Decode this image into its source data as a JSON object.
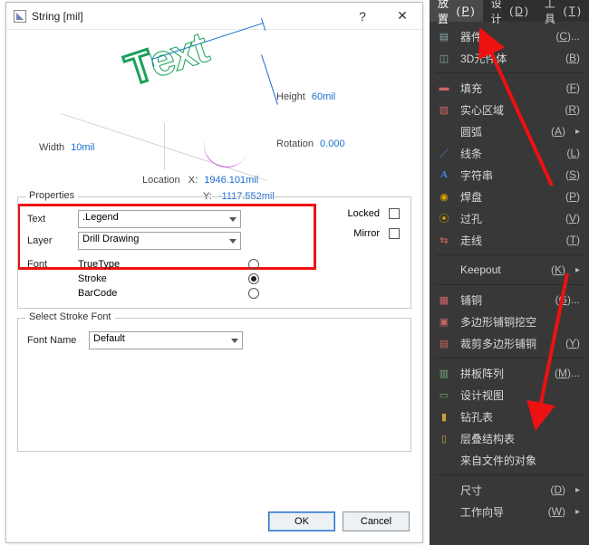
{
  "dialog": {
    "title": "String  [mil]",
    "preview_text": "Text",
    "height_label": "Height",
    "height_value": "60mil",
    "width_label": "Width",
    "width_value": "10mil",
    "rotation_label": "Rotation",
    "rotation_value": "0.000",
    "location_label": "Location",
    "x_label": "X:",
    "x_value": "1946.101mil",
    "y_label": "Y:",
    "y_value": "-1117.552mil",
    "properties": {
      "group_title": "Properties",
      "text_label": "Text",
      "text_value": ".Legend",
      "layer_label": "Layer",
      "layer_value": "Drill Drawing",
      "locked_label": "Locked",
      "locked_checked": false,
      "mirror_label": "Mirror",
      "mirror_checked": false,
      "font_label": "Font",
      "fonts": [
        {
          "label": "TrueType",
          "selected": false
        },
        {
          "label": "Stroke",
          "selected": true
        },
        {
          "label": "BarCode",
          "selected": false
        }
      ]
    },
    "stroke": {
      "group_title": "Select Stroke Font",
      "fontname_label": "Font Name",
      "fontname_value": "Default"
    },
    "buttons": {
      "ok": "OK",
      "cancel": "Cancel"
    },
    "title_help": "?",
    "title_close": "✕"
  },
  "menubar": {
    "place": {
      "label": "放置",
      "accel": "P"
    },
    "design": {
      "label": "设计",
      "accel": "D"
    },
    "tools": {
      "label": "工具",
      "accel": "T"
    }
  },
  "menu": [
    {
      "icon": "chip-icon",
      "label": "器件",
      "accel": "(C)...",
      "sub": false
    },
    {
      "icon": "cube-icon",
      "label": "3D元件体",
      "accel": "(B)",
      "sub": false
    },
    {
      "sep": true
    },
    {
      "icon": "fill-icon",
      "label": "填充",
      "accel": "(F)",
      "sub": false
    },
    {
      "icon": "region-icon",
      "label": "实心区域",
      "accel": "(R)",
      "sub": false
    },
    {
      "icon": "",
      "label": "圆弧",
      "accel": "(A)",
      "sub": true
    },
    {
      "icon": "line-icon",
      "label": "线条",
      "accel": "(L)",
      "sub": false
    },
    {
      "icon": "text-icon",
      "label": "字符串",
      "accel": "(S)",
      "sub": false
    },
    {
      "icon": "pad-icon",
      "label": "焊盘",
      "accel": "(P)",
      "sub": false
    },
    {
      "icon": "via-icon",
      "label": "过孔",
      "accel": "(V)",
      "sub": false
    },
    {
      "icon": "route-icon",
      "label": "走线",
      "accel": "(T)",
      "sub": false
    },
    {
      "sep": true
    },
    {
      "icon": "",
      "label": "Keepout",
      "accel": "(K)",
      "sub": true
    },
    {
      "sep": true
    },
    {
      "icon": "poly-icon",
      "label": "铺铜",
      "accel": "(G)...",
      "sub": false
    },
    {
      "icon": "polycut-icon",
      "label": "多边形铺铜挖空",
      "accel": "",
      "sub": false
    },
    {
      "icon": "polyclip-icon",
      "label": "裁剪多边形铺铜",
      "accel": "(Y)",
      "sub": false
    },
    {
      "sep": true
    },
    {
      "icon": "array-icon",
      "label": "拼板阵列",
      "accel": "(M)...",
      "sub": false
    },
    {
      "icon": "view-icon",
      "label": "设计视图",
      "accel": "",
      "sub": false
    },
    {
      "icon": "drill-icon",
      "label": "钻孔表",
      "accel": "",
      "sub": false
    },
    {
      "icon": "stack-icon",
      "label": "层叠结构表",
      "accel": "",
      "sub": false
    },
    {
      "icon": "",
      "label": "来自文件的对象",
      "accel": "",
      "sub": false
    },
    {
      "sep": true
    },
    {
      "icon": "",
      "label": "尺寸",
      "accel": "(D)",
      "sub": true
    },
    {
      "icon": "",
      "label": "工作向导",
      "accel": "(W)",
      "sub": true
    }
  ]
}
